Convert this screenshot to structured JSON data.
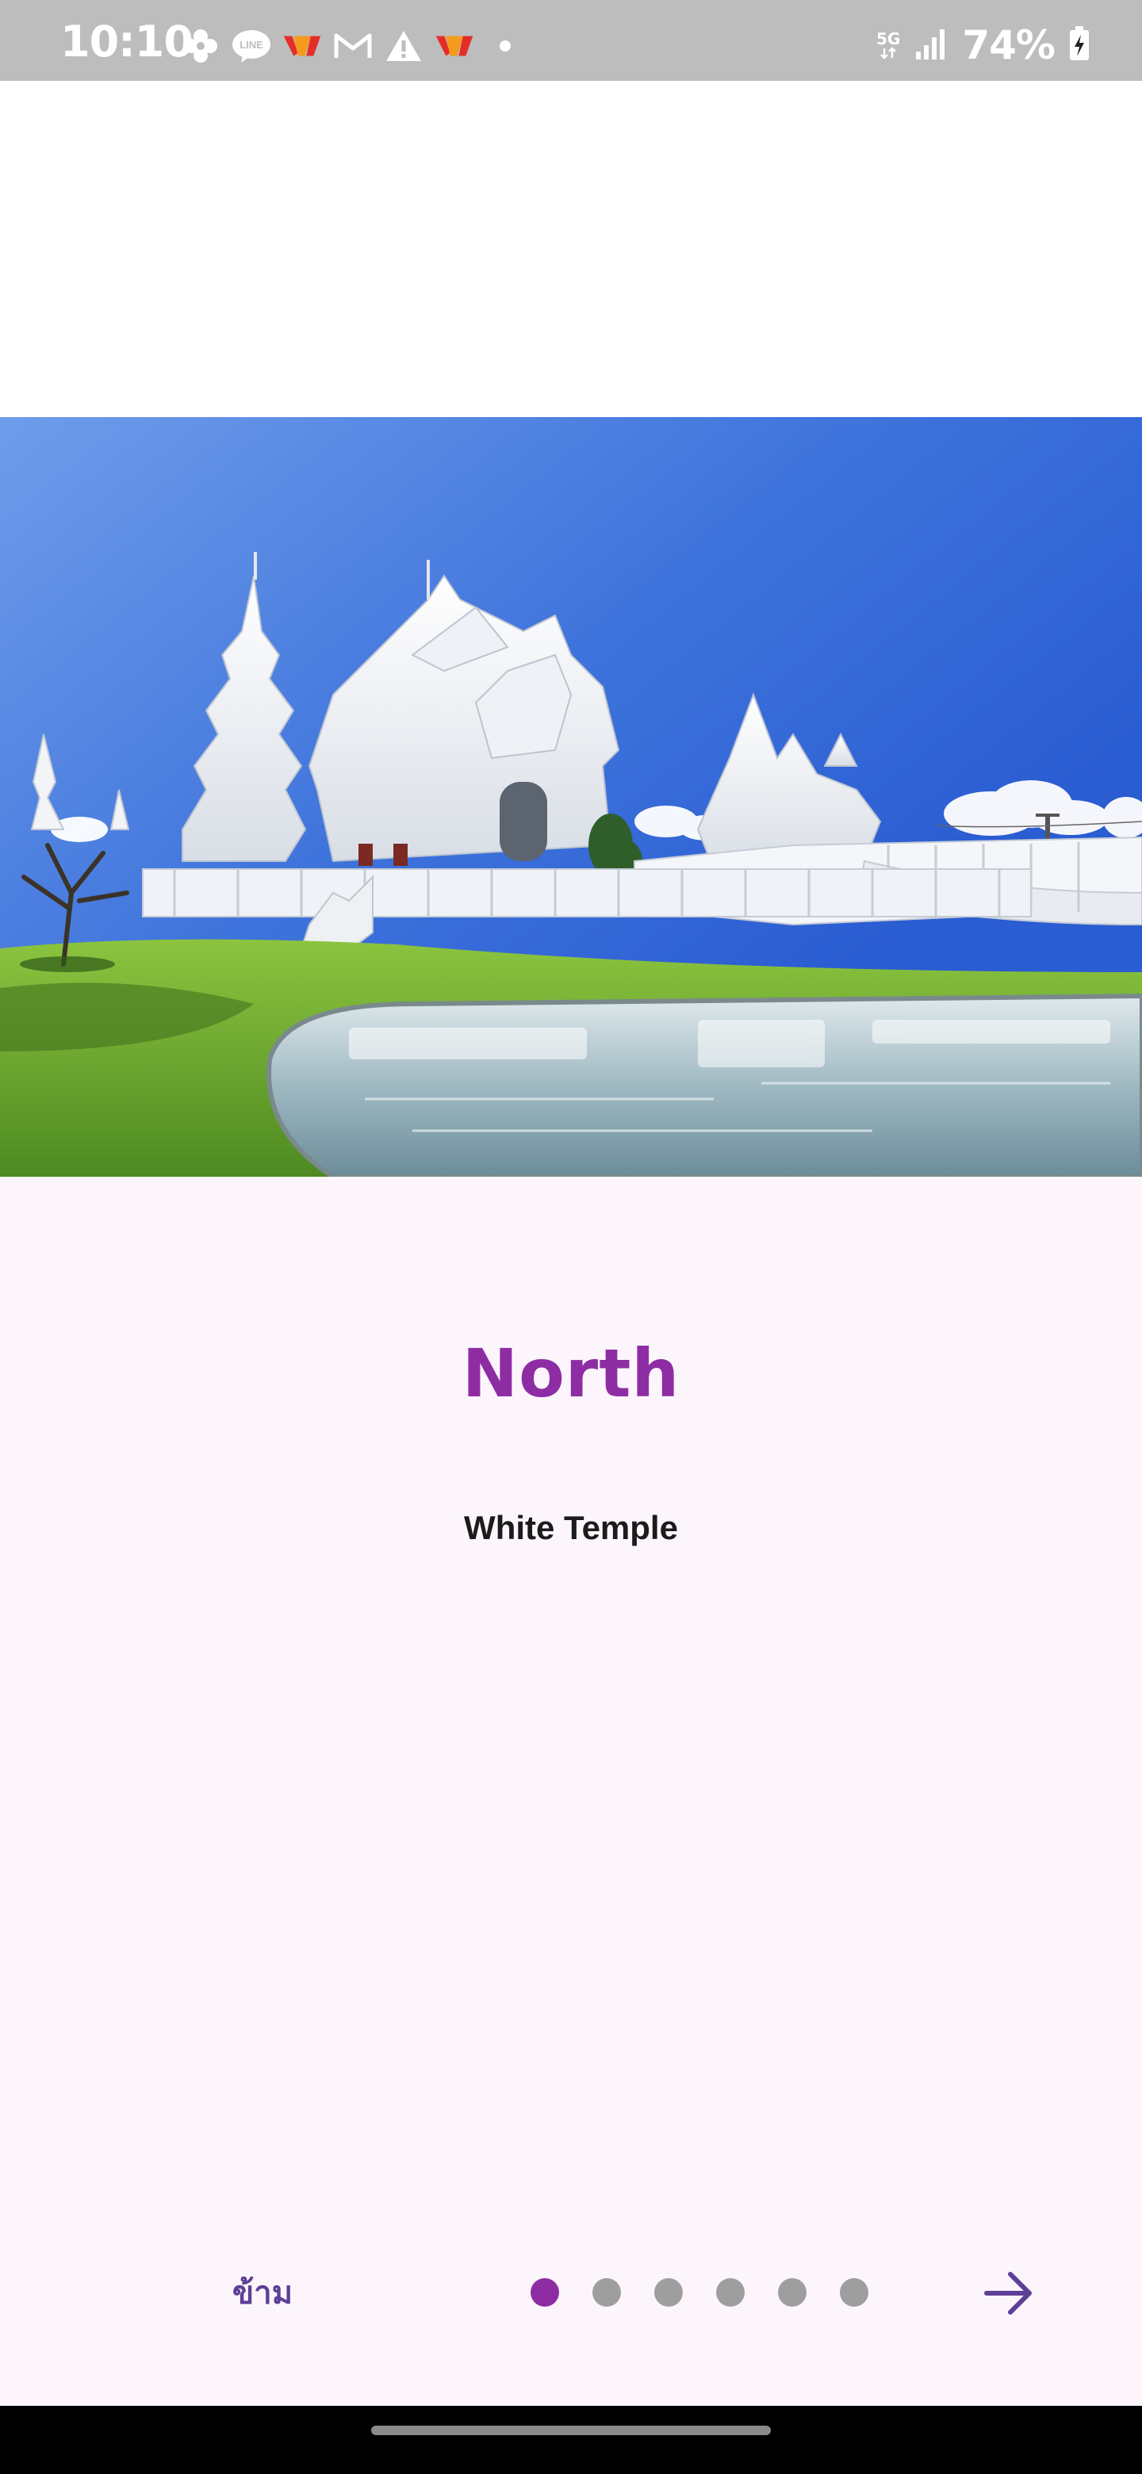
{
  "status_bar": {
    "time": "10:10",
    "left_icons": [
      "pinwheel-icon",
      "line-app-icon",
      "app-notification-icon",
      "gmail-icon",
      "warning-icon",
      "app-notification-icon",
      "dot-icon"
    ],
    "network_label": "5G",
    "battery_percent": "74%",
    "battery_charging": true
  },
  "hero": {
    "image_name": "white-temple-photo",
    "description_colors": {
      "sky": "#3a6bd8",
      "grass": "#6aa832",
      "water": "#b9cfd6"
    }
  },
  "content": {
    "region_title": "North",
    "place_name": "White Temple"
  },
  "navigation": {
    "skip_label": "ข้าม",
    "page_count": 6,
    "current_page": 1,
    "next_icon": "arrow-right-icon"
  },
  "colors": {
    "accent": "#8e2da3",
    "skip_text": "#5e3f96",
    "inactive_dot": "#9e9e9e",
    "background": "#fcf6fc"
  }
}
